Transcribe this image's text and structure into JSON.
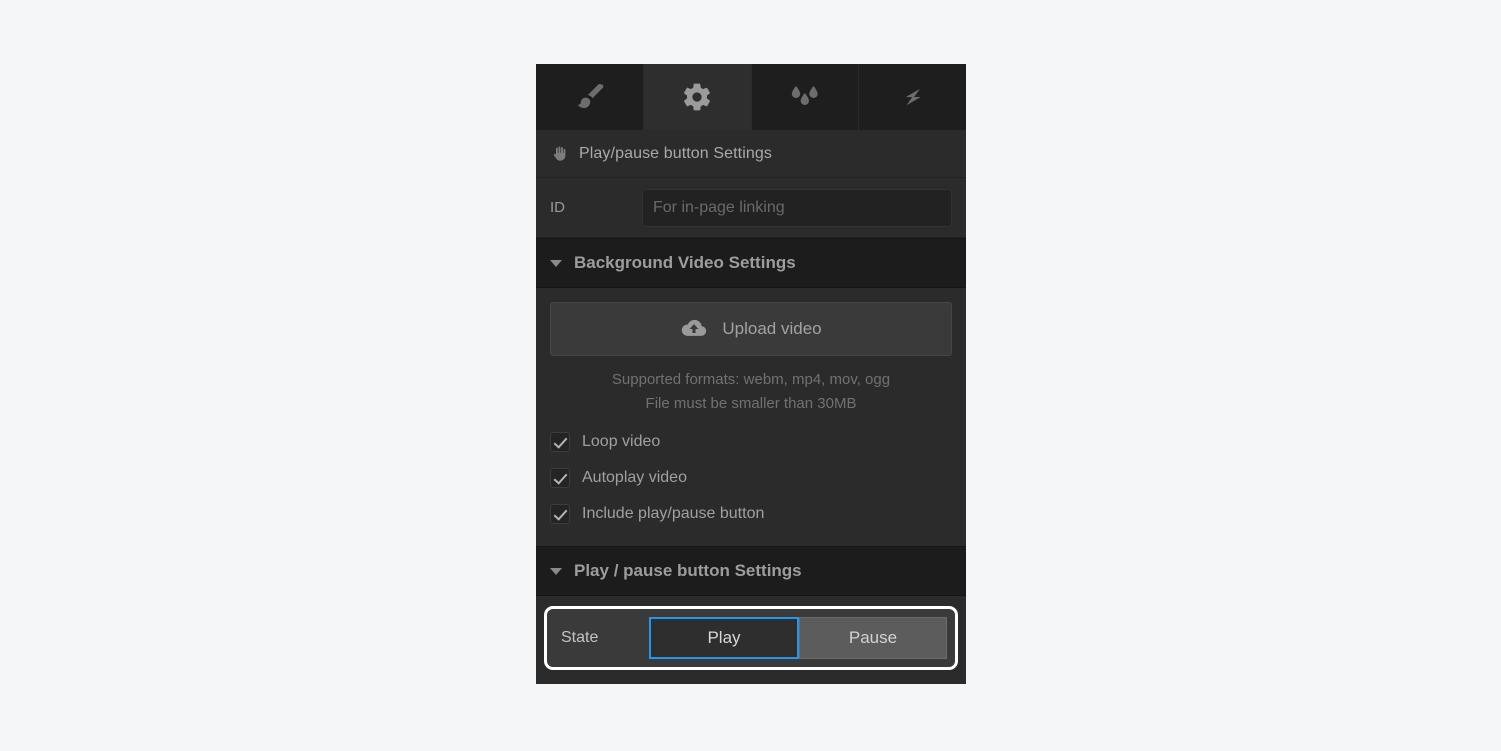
{
  "colors": {
    "panel_bg": "#2b2b2b",
    "header_bg": "#1c1c1c",
    "tabbar_bg": "#1e1e1e",
    "accent_blue": "#2196f3",
    "highlight_white": "#ffffff",
    "text": "#a8a8a8",
    "page_bg": "#f5f6f8"
  },
  "tabs": [
    {
      "id": "style",
      "icon": "paintbrush-icon",
      "label": "Style",
      "active": false
    },
    {
      "id": "settings",
      "icon": "gear-icon",
      "label": "Settings",
      "active": true
    },
    {
      "id": "effects",
      "icon": "droplets-icon",
      "label": "Effects",
      "active": false
    },
    {
      "id": "interactions",
      "icon": "lightning-icon",
      "label": "Interactions",
      "active": false
    }
  ],
  "element_title": {
    "icon": "hand-icon",
    "text": "Play/pause button Settings"
  },
  "id_field": {
    "label": "ID",
    "value": "",
    "placeholder": "For in-page linking"
  },
  "background_video_section": {
    "caret": "chevron-down-icon",
    "title": "Background Video Settings",
    "upload_button": {
      "icon": "cloud-upload-icon",
      "label": "Upload video"
    },
    "hint_line_1": "Supported formats: webm, mp4, mov, ogg",
    "hint_line_2": "File must be smaller than 30MB",
    "checkboxes": [
      {
        "id": "loop",
        "label": "Loop video",
        "checked": true
      },
      {
        "id": "autoplay",
        "label": "Autoplay video",
        "checked": true
      },
      {
        "id": "include",
        "label": "Include play/pause button",
        "checked": true
      }
    ]
  },
  "playpause_section": {
    "caret": "chevron-down-icon",
    "title": "Play / pause button Settings",
    "state_row": {
      "label": "State",
      "highlighted": true,
      "options": [
        {
          "id": "play",
          "label": "Play",
          "selected": true
        },
        {
          "id": "pause",
          "label": "Pause",
          "selected": false
        }
      ]
    }
  }
}
